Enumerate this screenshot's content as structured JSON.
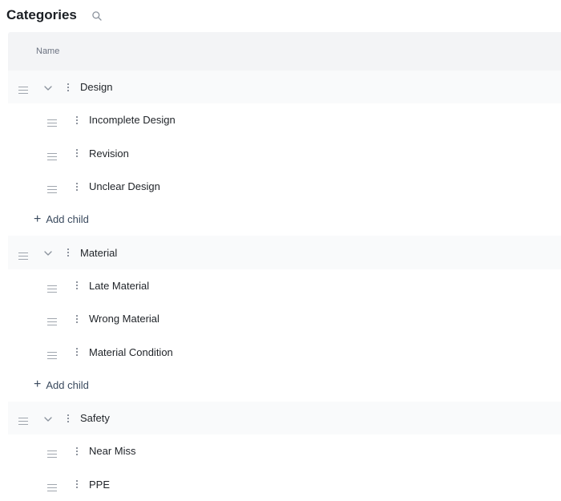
{
  "header": {
    "title": "Categories"
  },
  "table": {
    "column_name": "Name"
  },
  "add_child_label": "Add child",
  "groups": [
    {
      "label": "Design",
      "children": [
        "Incomplete Design",
        "Revision",
        "Unclear Design"
      ]
    },
    {
      "label": "Material",
      "children": [
        "Late Material",
        "Wrong Material",
        "Material Condition"
      ]
    },
    {
      "label": "Safety",
      "children": [
        "Near Miss",
        "PPE"
      ]
    }
  ],
  "colors": {
    "accent": "#3a4a5e",
    "header_bg": "#f3f4f6",
    "parent_row_bg": "#f9fafb"
  }
}
